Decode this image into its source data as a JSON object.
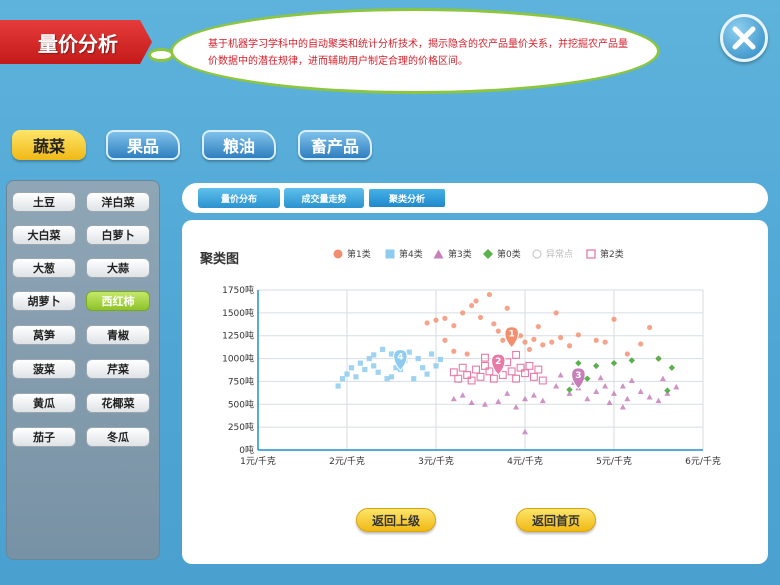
{
  "header": {
    "title": "量价分析",
    "description": "基于机器学习学科中的自动聚类和统计分析技术，揭示隐含的农产品量价关系，并挖掘农产品量价数据中的潜在规律，进而辅助用户制定合理的价格区间。"
  },
  "categories": [
    "蔬菜",
    "果品",
    "粮油",
    "畜产品"
  ],
  "active_category": "蔬菜",
  "vegetables": [
    "土豆",
    "洋白菜",
    "大白菜",
    "白萝卜",
    "大葱",
    "大蒜",
    "胡萝卜",
    "西红柿",
    "莴笋",
    "青椒",
    "菠菜",
    "芹菜",
    "黄瓜",
    "花椰菜",
    "茄子",
    "冬瓜"
  ],
  "selected_vegetable": "西红柿",
  "subtabs": [
    "量价分布",
    "成交量走势",
    "聚类分析"
  ],
  "active_subtab": "聚类分析",
  "buttons": {
    "back": "返回上级",
    "home": "返回首页"
  },
  "colors": {
    "c1": "#f28d6e",
    "c4": "#8ecbf0",
    "c3": "#c77fbc",
    "c0": "#5ab04c",
    "outlier": "#cccccc",
    "c2": "#e87aa8"
  },
  "chart_data": {
    "type": "scatter",
    "title": "聚类图",
    "xlim": [
      1,
      6
    ],
    "ylim": [
      0,
      1750
    ],
    "x_ticks": [
      "1元/千克",
      "2元/千克",
      "3元/千克",
      "4元/千克",
      "5元/千克",
      "6元/千克"
    ],
    "y_ticks": [
      "0吨",
      "250吨",
      "500吨",
      "750吨",
      "1000吨",
      "1250吨",
      "1500吨",
      "1750吨"
    ],
    "legend": [
      "第1类",
      "第4类",
      "第3类",
      "第0类",
      "异常点",
      "第2类"
    ],
    "series": [
      {
        "name": "第1类",
        "marker": "circle",
        "center_label": "1",
        "center": [
          3.85,
          1250
        ],
        "points": [
          [
            2.9,
            1390
          ],
          [
            3.0,
            1420
          ],
          [
            3.1,
            1440
          ],
          [
            3.2,
            1360
          ],
          [
            3.3,
            1500
          ],
          [
            3.4,
            1580
          ],
          [
            3.45,
            1630
          ],
          [
            3.5,
            1450
          ],
          [
            3.6,
            1700
          ],
          [
            3.65,
            1380
          ],
          [
            3.7,
            1300
          ],
          [
            3.75,
            1200
          ],
          [
            3.8,
            1550
          ],
          [
            3.85,
            1300
          ],
          [
            3.9,
            1230
          ],
          [
            3.95,
            1250
          ],
          [
            4.0,
            1180
          ],
          [
            4.05,
            1100
          ],
          [
            4.1,
            1210
          ],
          [
            4.15,
            1350
          ],
          [
            4.2,
            1150
          ],
          [
            4.3,
            1180
          ],
          [
            4.35,
            1500
          ],
          [
            4.4,
            1230
          ],
          [
            4.5,
            1140
          ],
          [
            4.6,
            1260
          ],
          [
            4.8,
            1200
          ],
          [
            4.9,
            1180
          ],
          [
            5.0,
            1430
          ],
          [
            5.15,
            1050
          ],
          [
            5.3,
            1160
          ],
          [
            5.4,
            1340
          ],
          [
            5.5,
            1000
          ],
          [
            3.2,
            1080
          ],
          [
            3.35,
            1050
          ],
          [
            3.1,
            1200
          ]
        ]
      },
      {
        "name": "第4类",
        "marker": "square",
        "center_label": "4",
        "center": [
          2.6,
          1000
        ],
        "points": [
          [
            1.9,
            700
          ],
          [
            1.95,
            780
          ],
          [
            2.0,
            830
          ],
          [
            2.05,
            900
          ],
          [
            2.1,
            800
          ],
          [
            2.15,
            950
          ],
          [
            2.2,
            880
          ],
          [
            2.25,
            1000
          ],
          [
            2.3,
            920
          ],
          [
            2.35,
            850
          ],
          [
            2.4,
            1100
          ],
          [
            2.45,
            780
          ],
          [
            2.5,
            1050
          ],
          [
            2.55,
            900
          ],
          [
            2.6,
            880
          ],
          [
            2.65,
            980
          ],
          [
            2.7,
            1070
          ],
          [
            2.75,
            780
          ],
          [
            2.8,
            1000
          ],
          [
            2.85,
            900
          ],
          [
            2.9,
            830
          ],
          [
            2.95,
            1050
          ],
          [
            3.0,
            920
          ],
          [
            3.05,
            990
          ],
          [
            2.3,
            1040
          ],
          [
            2.5,
            800
          ]
        ]
      },
      {
        "name": "第3类",
        "marker": "triangle",
        "center_label": "3",
        "center": [
          4.6,
          800
        ],
        "points": [
          [
            3.2,
            560
          ],
          [
            3.3,
            600
          ],
          [
            3.4,
            520
          ],
          [
            3.55,
            500
          ],
          [
            3.7,
            530
          ],
          [
            3.8,
            620
          ],
          [
            3.9,
            470
          ],
          [
            4.0,
            200
          ],
          [
            4.0,
            560
          ],
          [
            4.1,
            600
          ],
          [
            4.2,
            540
          ],
          [
            4.35,
            700
          ],
          [
            4.5,
            620
          ],
          [
            4.55,
            740
          ],
          [
            4.6,
            680
          ],
          [
            4.7,
            560
          ],
          [
            4.8,
            640
          ],
          [
            4.85,
            790
          ],
          [
            4.9,
            700
          ],
          [
            4.95,
            520
          ],
          [
            5.0,
            620
          ],
          [
            5.1,
            700
          ],
          [
            5.15,
            560
          ],
          [
            5.2,
            760
          ],
          [
            5.3,
            640
          ],
          [
            5.4,
            580
          ],
          [
            5.5,
            540
          ],
          [
            5.6,
            620
          ],
          [
            5.7,
            690
          ],
          [
            5.55,
            780
          ],
          [
            5.1,
            470
          ],
          [
            4.4,
            820
          ]
        ]
      },
      {
        "name": "第0类",
        "marker": "diamond",
        "points": [
          [
            4.5,
            660
          ],
          [
            4.7,
            780
          ],
          [
            4.8,
            920
          ],
          [
            5.0,
            950
          ],
          [
            5.2,
            980
          ],
          [
            5.5,
            1000
          ],
          [
            5.65,
            900
          ],
          [
            5.6,
            650
          ],
          [
            4.6,
            950
          ]
        ]
      },
      {
        "name": "第2类",
        "marker": "hollow-square",
        "center_label": "2",
        "center": [
          3.7,
          950
        ],
        "points": [
          [
            3.2,
            850
          ],
          [
            3.25,
            780
          ],
          [
            3.3,
            900
          ],
          [
            3.35,
            820
          ],
          [
            3.4,
            760
          ],
          [
            3.45,
            880
          ],
          [
            3.5,
            800
          ],
          [
            3.55,
            920
          ],
          [
            3.6,
            860
          ],
          [
            3.65,
            780
          ],
          [
            3.7,
            900
          ],
          [
            3.75,
            820
          ],
          [
            3.8,
            960
          ],
          [
            3.85,
            860
          ],
          [
            3.9,
            780
          ],
          [
            3.95,
            900
          ],
          [
            4.0,
            840
          ],
          [
            4.05,
            920
          ],
          [
            4.1,
            800
          ],
          [
            4.15,
            880
          ],
          [
            3.55,
            1010
          ],
          [
            3.9,
            1040
          ],
          [
            4.2,
            760
          ]
        ]
      }
    ]
  }
}
